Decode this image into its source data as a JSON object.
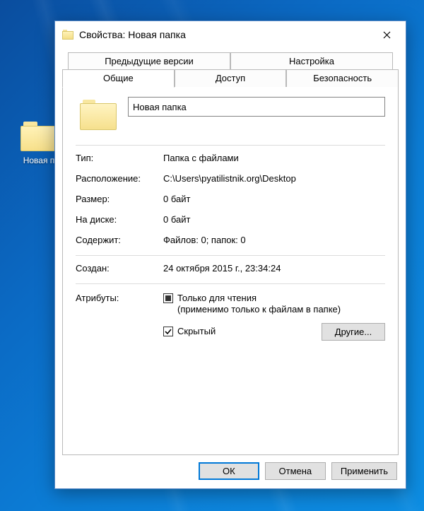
{
  "desktop": {
    "folder_label": "Новая п"
  },
  "dialog": {
    "title": "Свойства: Новая папка",
    "tabs": {
      "back": [
        "Предыдущие версии",
        "Настройка"
      ],
      "front": [
        "Общие",
        "Доступ",
        "Безопасность"
      ],
      "active": "Общие"
    },
    "name_value": "Новая папка",
    "fields": {
      "type_label": "Тип:",
      "type_value": "Папка с файлами",
      "location_label": "Расположение:",
      "location_value": "C:\\Users\\pyatilistnik.org\\Desktop",
      "size_label": "Размер:",
      "size_value": "0 байт",
      "ondisk_label": "На диске:",
      "ondisk_value": "0 байт",
      "contains_label": "Содержит:",
      "contains_value": "Файлов: 0; папок: 0",
      "created_label": "Создан:",
      "created_value": "24 октября 2015 г., 23:34:24"
    },
    "attributes": {
      "label": "Атрибуты:",
      "readonly_label": "Только для чтения",
      "readonly_sub": "(применимо только к файлам в папке)",
      "hidden_label": "Скрытый",
      "other_button": "Другие..."
    },
    "buttons": {
      "ok": "ОК",
      "cancel": "Отмена",
      "apply": "Применить"
    }
  }
}
